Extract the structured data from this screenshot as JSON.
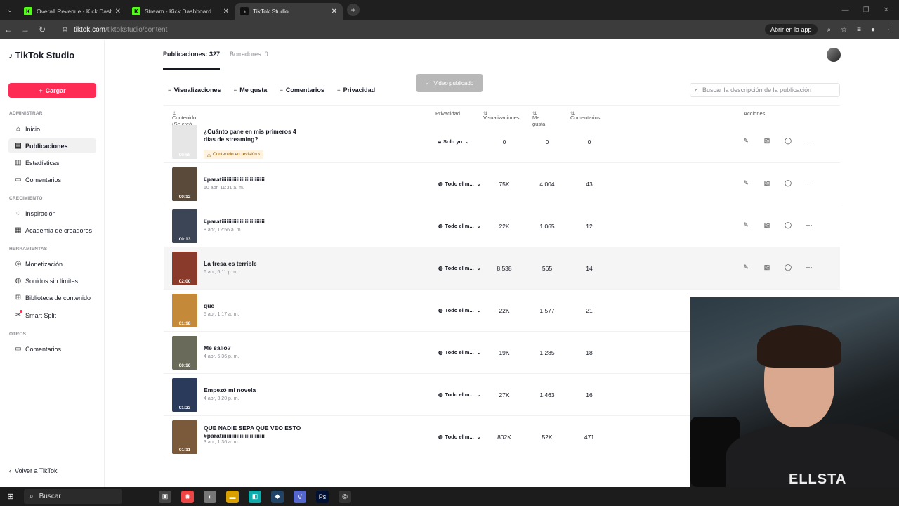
{
  "browser": {
    "tabs": [
      {
        "title": "Overall Revenue - Kick Dashboard",
        "icon": "kick-logo"
      },
      {
        "title": "Stream - Kick Dashboard",
        "icon": "kick-logo"
      },
      {
        "title": "TikTok Studio",
        "icon": "tiktok-logo"
      }
    ],
    "url_host": "tiktok.com",
    "url_path": "/tiktokstudio/content",
    "open_in_app": "Abrir en la app"
  },
  "sidebar": {
    "logo": "TikTok Studio",
    "upload": "Cargar",
    "sections": {
      "admin": "ADMINISTRAR",
      "growth": "CRECIMIENTO",
      "tools": "HERRAMIENTAS",
      "others": "OTROS"
    },
    "items": {
      "home": "Inicio",
      "posts": "Publicaciones",
      "stats": "Estadísticas",
      "comments": "Comentarios",
      "inspiration": "Inspiración",
      "academy": "Academia de creadores",
      "monetization": "Monetización",
      "sounds": "Sonidos sin límites",
      "library": "Biblioteca de contenido",
      "smartsplit": "Smart Split",
      "comments2": "Comentarios"
    },
    "back": "Volver a TikTok"
  },
  "main": {
    "tab_posts": "Publicaciones: 327",
    "tab_drafts": "Borradores: 0",
    "toast": "Video publicado",
    "filters": [
      "Visualizaciones",
      "Me gusta",
      "Comentarios",
      "Privacidad"
    ],
    "search_placeholder": "Buscar la descripción de la publicación",
    "columns": {
      "content": "Contenido (Se creó el)",
      "privacy": "Privacidad",
      "views": "Visualizaciones",
      "likes": "Me gusta",
      "comments": "Comentarios",
      "actions": "Acciones"
    },
    "rows": [
      {
        "title": "¿Cuánto gane en mis primeros 4 días de streaming?",
        "date": "",
        "badge": "Contenido en revisión",
        "duration": "00:58",
        "privacy": "Solo yo",
        "views": "0",
        "likes": "0",
        "comments": "0"
      },
      {
        "title": "#paratiiiiiiiiiiiiiiiiiiiiiiiiii",
        "date": "10 abr, 11:31 a. m.",
        "badge": "",
        "duration": "00:12",
        "privacy": "Todo el m...",
        "views": "75K",
        "likes": "4,004",
        "comments": "43"
      },
      {
        "title": "#paratiiiiiiiiiiiiiiiiiiiiiiiiii",
        "date": "8 abr, 12:56 a. m.",
        "badge": "",
        "duration": "00:13",
        "privacy": "Todo el m...",
        "views": "22K",
        "likes": "1,065",
        "comments": "12"
      },
      {
        "title": "La fresa es terrible",
        "date": "6 abr, 6:11 p. m.",
        "badge": "",
        "duration": "02:00",
        "privacy": "Todo el m...",
        "views": "8,538",
        "likes": "565",
        "comments": "14"
      },
      {
        "title": "que",
        "date": "5 abr, 1:17 a. m.",
        "badge": "",
        "duration": "01:18",
        "privacy": "Todo el m...",
        "views": "22K",
        "likes": "1,577",
        "comments": "21"
      },
      {
        "title": "Me salio?",
        "date": "4 abr, 5:36 p. m.",
        "badge": "",
        "duration": "00:16",
        "privacy": "Todo el m...",
        "views": "19K",
        "likes": "1,285",
        "comments": "18"
      },
      {
        "title": "Empezó mi novela",
        "date": "4 abr, 3:20 p. m.",
        "badge": "",
        "duration": "01:23",
        "privacy": "Todo el m...",
        "views": "27K",
        "likes": "1,463",
        "comments": "16"
      },
      {
        "title": "QUE NADIE SEPA QUE VEO ESTO #paratiiiiiiiiiiiiiiiiiiiiiiiiii",
        "date": "3 abr, 1:36 a. m.",
        "badge": "",
        "duration": "01:11",
        "privacy": "Todo el m...",
        "views": "802K",
        "likes": "52K",
        "comments": "471"
      }
    ]
  },
  "webcam": {
    "shirt_text": "ELLSTA"
  },
  "taskbar": {
    "search": "Buscar"
  },
  "colors": {
    "accent": "#fe2c55",
    "kick": "#53fc18"
  }
}
